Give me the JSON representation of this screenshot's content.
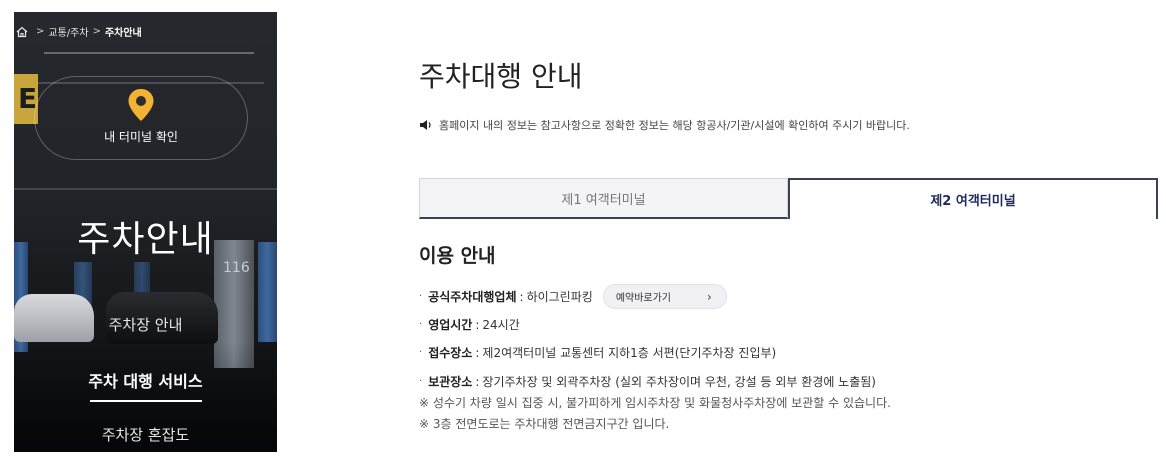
{
  "breadcrumb": {
    "items": [
      "교통/주차",
      "주차안내"
    ]
  },
  "sidebar": {
    "terminal_check_label": "내 터미널 확인",
    "title": "주차안내",
    "menu": [
      {
        "label": "주차장 안내",
        "active": false
      },
      {
        "label": "주차 대행 서비스",
        "active": true
      },
      {
        "label": "주차장 혼잡도",
        "active": false
      }
    ],
    "pillar_number": "116",
    "sign_letter": "E"
  },
  "main": {
    "title": "주차대행 안내",
    "notice": "홈페이지 내의 정보는 참고사항으로 정확한 정보는 해당 항공사/기관/시설에 확인하여 주시기 바랍니다.",
    "tabs": [
      {
        "label": "제1 여객터미널",
        "active": false
      },
      {
        "label": "제2 여객터미널",
        "active": true
      }
    ],
    "section_title": "이용 안내",
    "info_rows": [
      {
        "key": "공식주차대행업체",
        "value": "하이그린파킹"
      },
      {
        "key": "영업시간",
        "value": "24시간"
      },
      {
        "key": "접수장소",
        "value": "제2여객터미널 교통센터 지하1층 서편(단기주차장 진입부)"
      },
      {
        "key": "보관장소",
        "value": "장기주차장 및 외곽주차장 (실외 주차장이며 우천, 강설 등 외부 환경에 노출됨)"
      }
    ],
    "reserve_button_label": "예약바로가기",
    "notes": [
      "※ 성수기 차량 일시 집중 시, 불가피하게 임시주차장 및 화물청사주차장에 보관할 수 있습니다.",
      "※ 3층 전면도로는 주차대행 전면금지구간 입니다."
    ]
  },
  "colors": {
    "pin_accent": "#f2b233",
    "tab_border": "#3c3f5a",
    "active_tab_text": "#1f2b5a"
  }
}
